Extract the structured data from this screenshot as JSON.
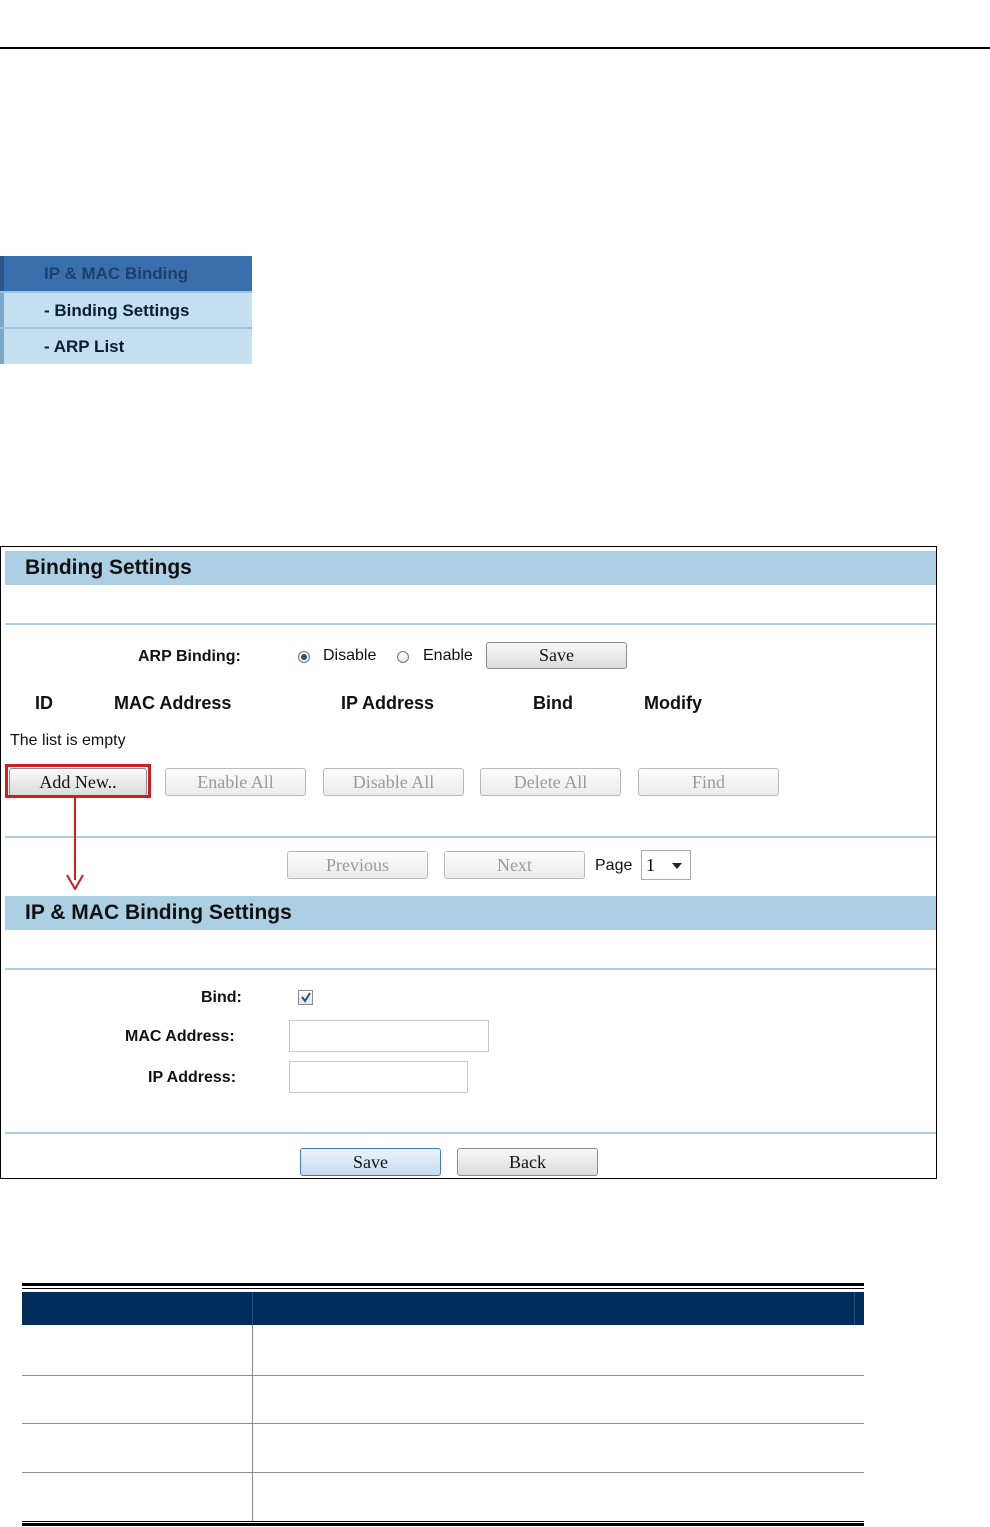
{
  "menu": {
    "items": [
      "IP & MAC Binding",
      "- Binding Settings",
      "- ARP List"
    ]
  },
  "binding_settings": {
    "title": "Binding Settings",
    "arp_binding_label": "ARP Binding:",
    "options": [
      "Disable",
      "Enable"
    ],
    "selected_option": "Disable",
    "save_label": "Save",
    "columns": [
      "ID",
      "MAC Address",
      "IP Address",
      "Bind",
      "Modify"
    ],
    "empty_text": "The list is empty",
    "buttons": [
      "Add New..",
      "Enable All",
      "Disable All",
      "Delete All",
      "Find"
    ],
    "pager": {
      "previous": "Previous",
      "next": "Next",
      "page_label": "Page",
      "page_value": "1"
    }
  },
  "ip_mac_settings": {
    "title": "IP & MAC Binding Settings",
    "bind_label": "Bind:",
    "bind_checked": true,
    "mac_label": "MAC Address:",
    "mac_value": "",
    "ip_label": "IP Address:",
    "ip_value": "",
    "save_label": "Save",
    "back_label": "Back"
  },
  "colors": {
    "header_bar": "#adcfe3",
    "highlight": "#d01d1d",
    "table_header": "#002d5c",
    "menu_active": "#3a6fae",
    "menu_item": "#c3dff0"
  }
}
